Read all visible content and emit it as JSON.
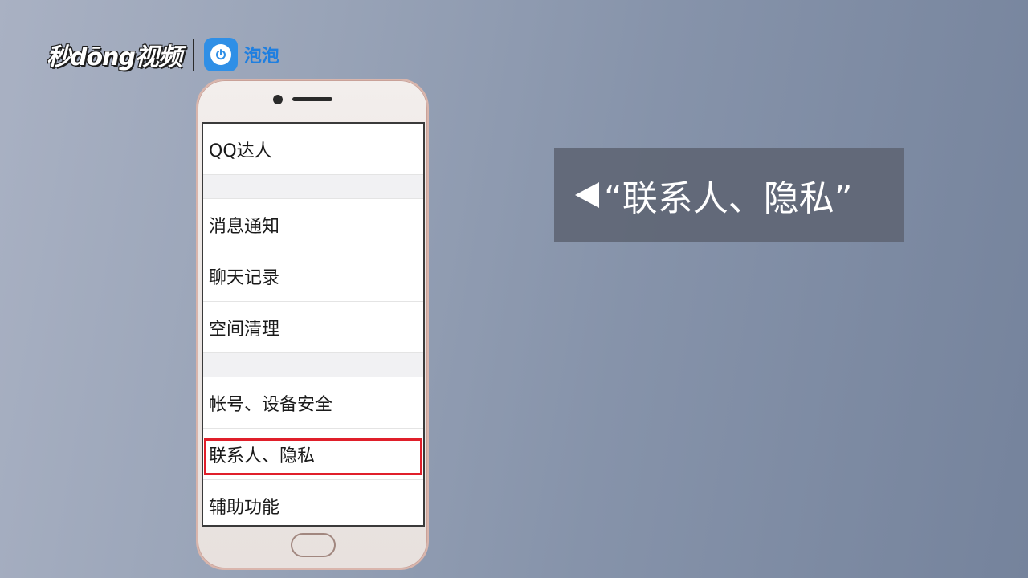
{
  "watermark": {
    "brand_text": "秒dōng视频",
    "sub_label": "泡泡",
    "badge_icon": "power-bubble-icon",
    "badge_color": "#2f8fe6"
  },
  "settings_list": {
    "items": [
      {
        "label": "QQ达人"
      },
      {
        "label": "消息通知"
      },
      {
        "label": "聊天记录"
      },
      {
        "label": "空间清理"
      },
      {
        "label": "帐号、设备安全"
      },
      {
        "label": "联系人、隐私"
      },
      {
        "label": "辅助功能"
      }
    ],
    "highlighted_item": "联系人、隐私",
    "highlight_color": "#e01f2a"
  },
  "caption": {
    "text": "“联系人、隐私”",
    "pointer_icon": "left-triangle-icon"
  }
}
